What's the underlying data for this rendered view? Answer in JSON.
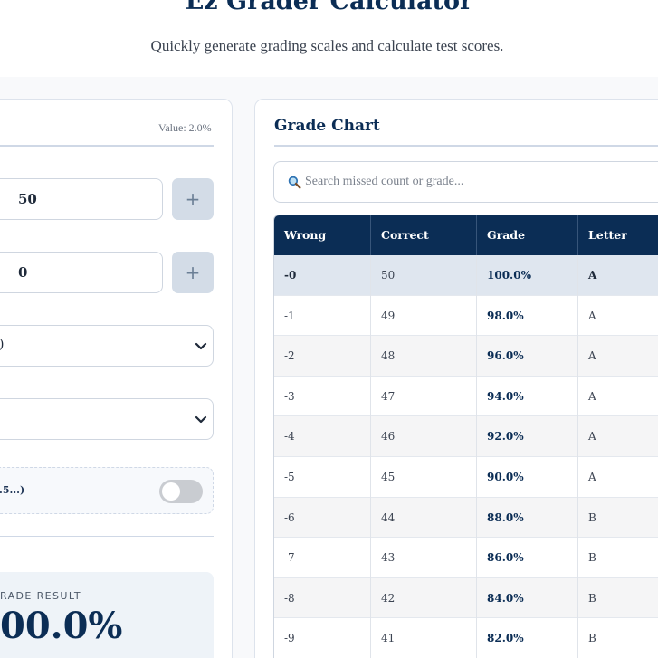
{
  "header": {
    "title": "Ez Grader Calculator",
    "tagline": "Quickly generate grading scales and calculate test scores."
  },
  "settings": {
    "value_readout": "Value: 2.0%",
    "total_questions": {
      "value": "50",
      "increment_label": "+"
    },
    "wrong_answers": {
      "value": "0",
      "increment_label": "+"
    },
    "select1_partial": ")",
    "select2_partial": "",
    "toggle": {
      "partial_label": ".5...)",
      "state": "off"
    },
    "result_label": "RADE RESULT",
    "result_value": "00.0%"
  },
  "grade_chart": {
    "title": "Grade Chart",
    "search_placeholder": "Search missed count or grade...",
    "columns": [
      "Wrong",
      "Correct",
      "Grade",
      "Letter"
    ],
    "rows": [
      {
        "wrong": "-0",
        "correct": "50",
        "grade": "100.0%",
        "letter": "A"
      },
      {
        "wrong": "-1",
        "correct": "49",
        "grade": "98.0%",
        "letter": "A"
      },
      {
        "wrong": "-2",
        "correct": "48",
        "grade": "96.0%",
        "letter": "A"
      },
      {
        "wrong": "-3",
        "correct": "47",
        "grade": "94.0%",
        "letter": "A"
      },
      {
        "wrong": "-4",
        "correct": "46",
        "grade": "92.0%",
        "letter": "A"
      },
      {
        "wrong": "-5",
        "correct": "45",
        "grade": "90.0%",
        "letter": "A"
      },
      {
        "wrong": "-6",
        "correct": "44",
        "grade": "88.0%",
        "letter": "B"
      },
      {
        "wrong": "-7",
        "correct": "43",
        "grade": "86.0%",
        "letter": "B"
      },
      {
        "wrong": "-8",
        "correct": "42",
        "grade": "84.0%",
        "letter": "B"
      },
      {
        "wrong": "-9",
        "correct": "41",
        "grade": "82.0%",
        "letter": "B"
      }
    ]
  },
  "colors": {
    "primary_navy": "#0b2d55",
    "step_button": "#d3dce7",
    "selected_row": "#dfe6ef",
    "result_panel": "#eef3f8"
  }
}
